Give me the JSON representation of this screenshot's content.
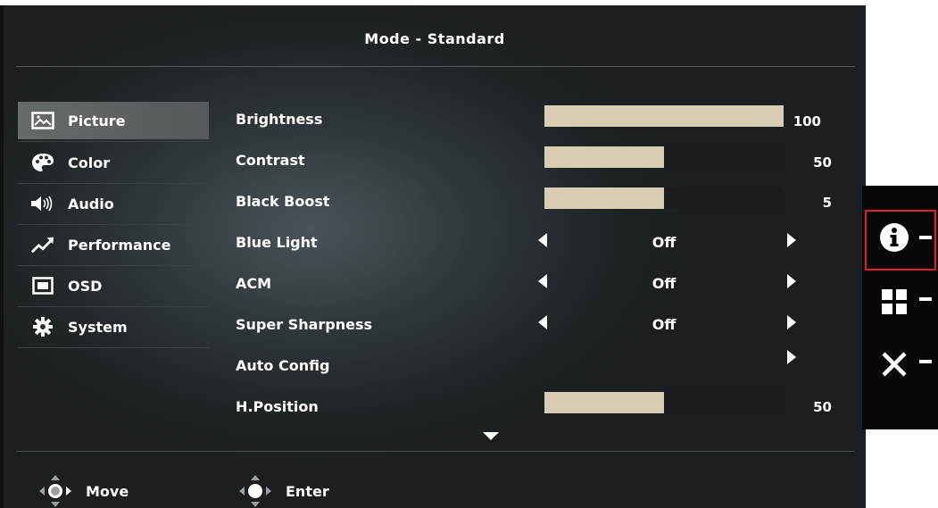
{
  "header": {
    "title": "Mode - Standard"
  },
  "sidebar": {
    "items": [
      {
        "label": "Picture",
        "icon": "picture-icon",
        "active": true
      },
      {
        "label": "Color",
        "icon": "palette-icon",
        "active": false
      },
      {
        "label": "Audio",
        "icon": "speaker-icon",
        "active": false
      },
      {
        "label": "Performance",
        "icon": "trend-arrow-icon",
        "active": false
      },
      {
        "label": "OSD",
        "icon": "osd-window-icon",
        "active": false
      },
      {
        "label": "System",
        "icon": "gear-icon",
        "active": false
      }
    ]
  },
  "settings": {
    "brightness": {
      "label": "Brightness",
      "value": "100",
      "fill_fraction": 1.0
    },
    "contrast": {
      "label": "Contrast",
      "value": "50",
      "fill_fraction": 0.5
    },
    "black_boost": {
      "label": "Black Boost",
      "value": "5",
      "fill_fraction": 0.5
    },
    "blue_light": {
      "label": "Blue Light",
      "value": "Off"
    },
    "acm": {
      "label": "ACM",
      "value": "Off"
    },
    "super_sharpness": {
      "label": "Super Sharpness",
      "value": "Off"
    },
    "auto_config": {
      "label": "Auto Config"
    },
    "h_position": {
      "label": "H.Position",
      "value": "50",
      "fill_fraction": 0.5
    }
  },
  "footer": {
    "move_label": "Move",
    "enter_label": "Enter"
  },
  "hotkeys": [
    {
      "icon": "info-icon",
      "highlighted": true
    },
    {
      "icon": "menu-grid-icon",
      "highlighted": false
    },
    {
      "icon": "close-icon",
      "highlighted": false
    }
  ],
  "colors": {
    "bar_fill": "#d8ccb3",
    "highlight_border": "#e0201f",
    "active_item_bg": "#656a6c"
  }
}
